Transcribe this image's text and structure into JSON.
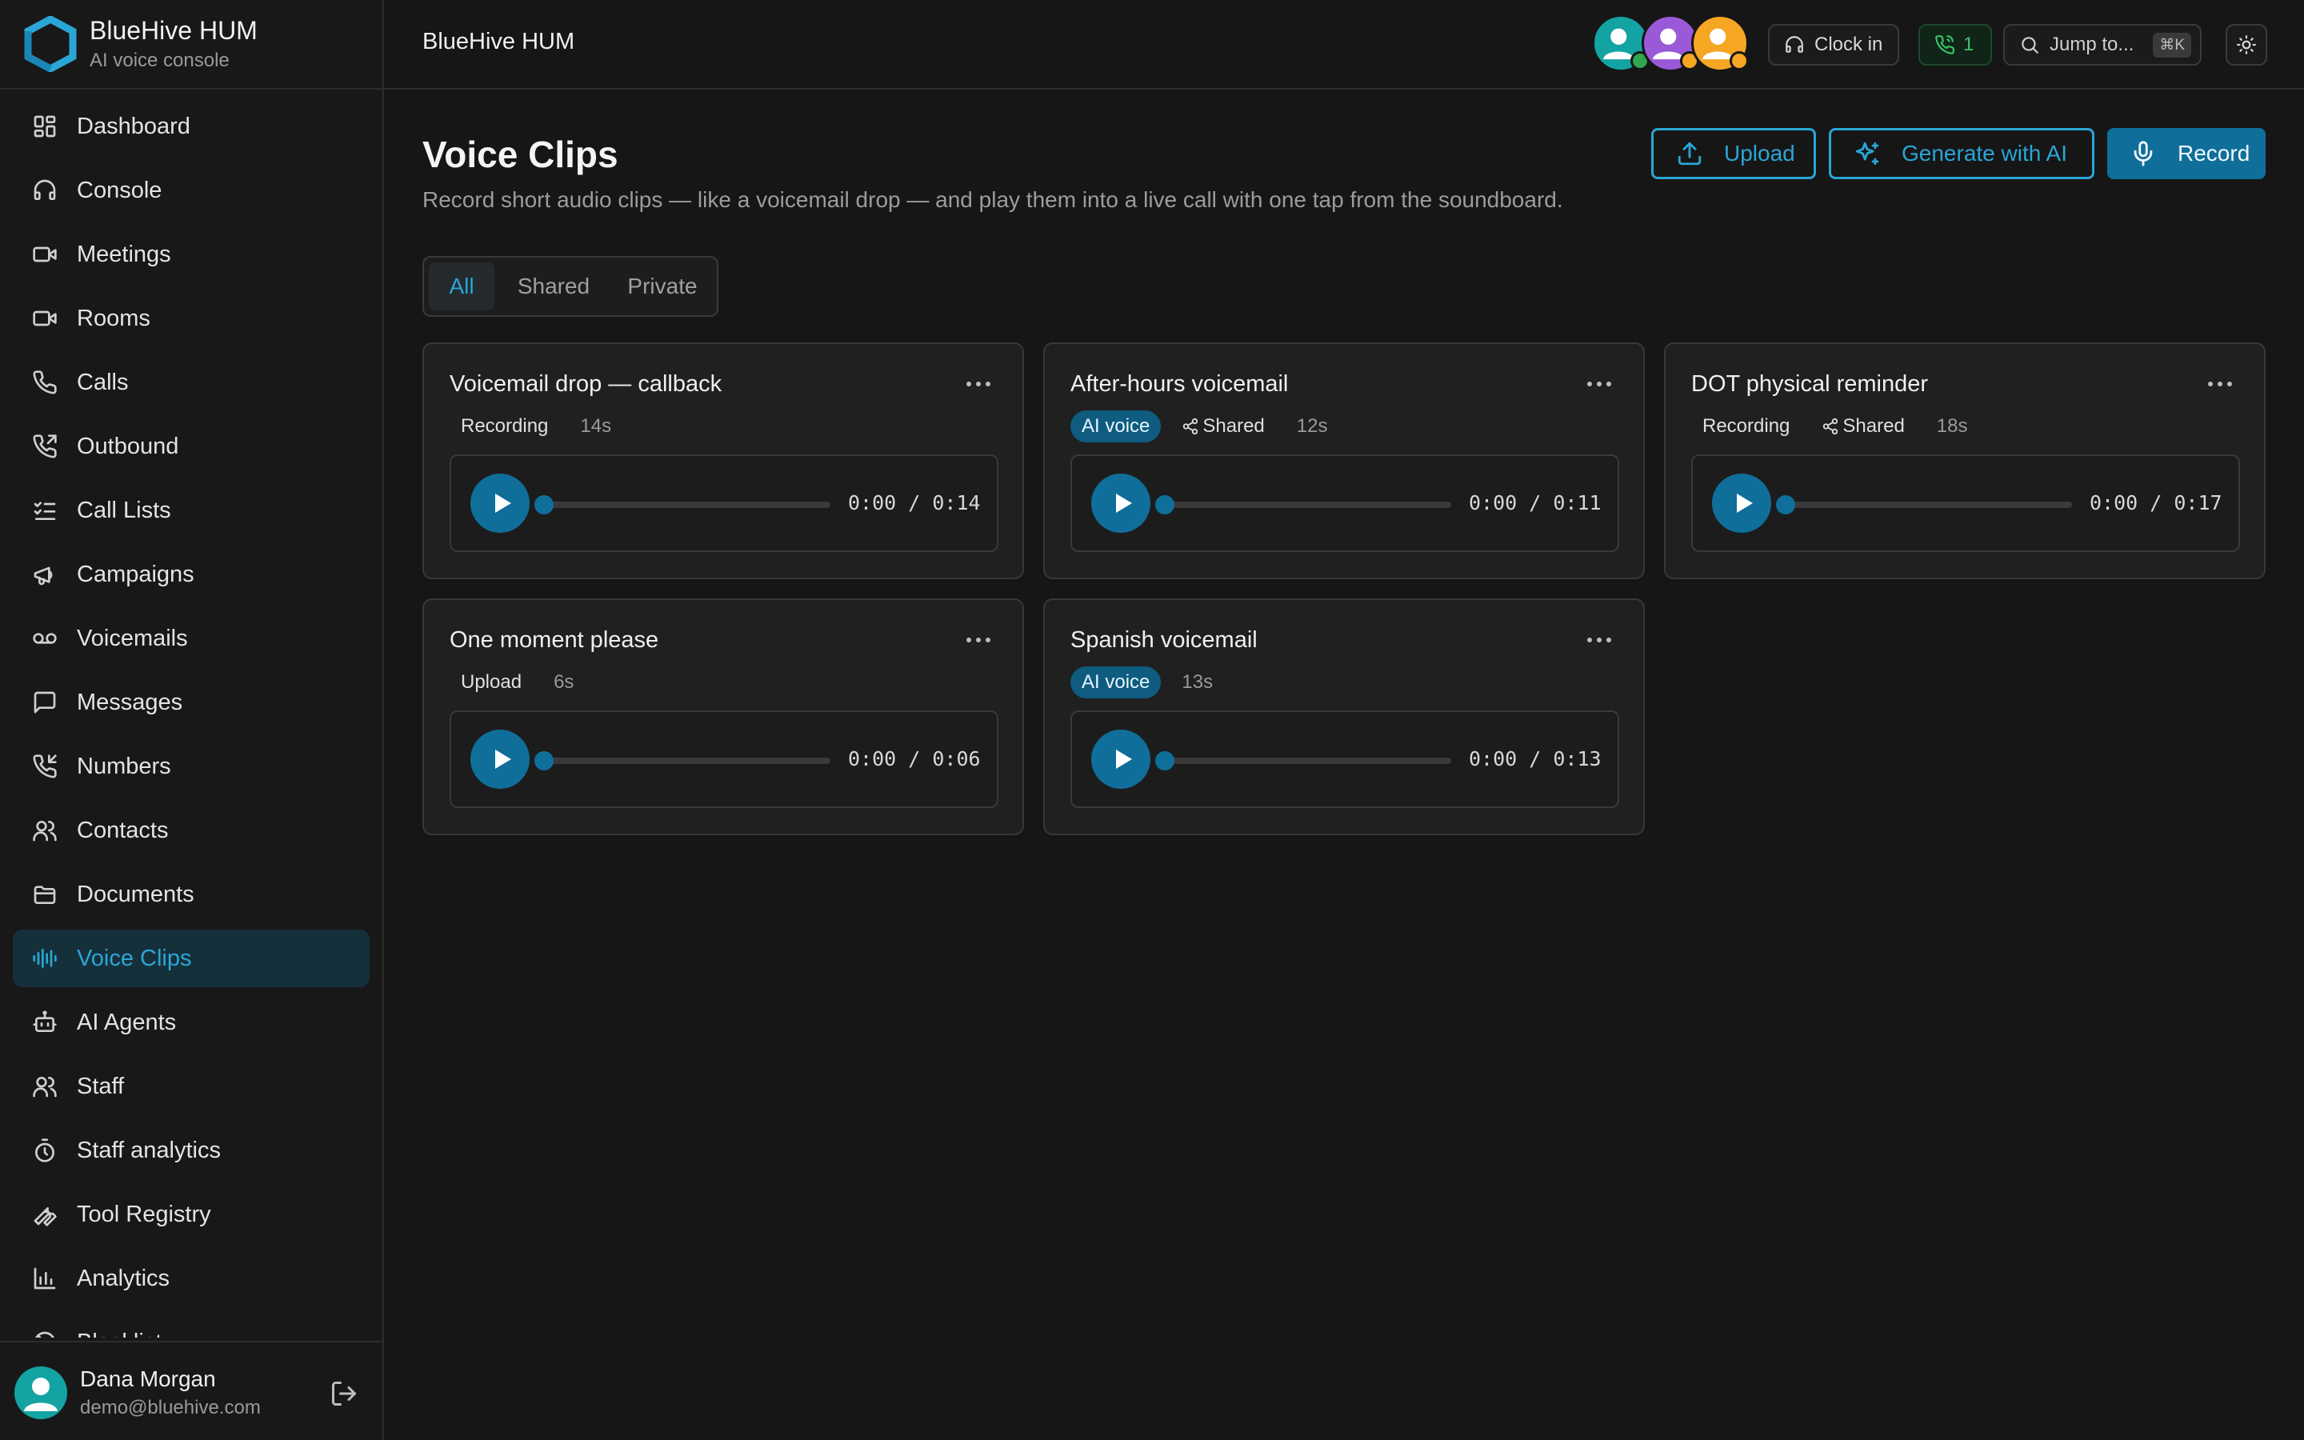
{
  "brand": {
    "title": "BlueHive HUM",
    "subtitle": "AI voice console"
  },
  "sidebar": {
    "items": [
      {
        "label": "Dashboard",
        "icon": "dashboard-icon"
      },
      {
        "label": "Console",
        "icon": "headset-icon"
      },
      {
        "label": "Meetings",
        "icon": "video-icon"
      },
      {
        "label": "Rooms",
        "icon": "video-icon"
      },
      {
        "label": "Calls",
        "icon": "phone-icon"
      },
      {
        "label": "Outbound",
        "icon": "phone-outgoing-icon"
      },
      {
        "label": "Call Lists",
        "icon": "list-checks-icon"
      },
      {
        "label": "Campaigns",
        "icon": "megaphone-icon"
      },
      {
        "label": "Voicemails",
        "icon": "voicemail-icon"
      },
      {
        "label": "Messages",
        "icon": "message-icon"
      },
      {
        "label": "Numbers",
        "icon": "phone-incoming-icon"
      },
      {
        "label": "Contacts",
        "icon": "users-icon"
      },
      {
        "label": "Documents",
        "icon": "folder-icon"
      },
      {
        "label": "Voice Clips",
        "icon": "audio-wave-icon",
        "active": true
      },
      {
        "label": "AI Agents",
        "icon": "bot-icon"
      },
      {
        "label": "Staff",
        "icon": "users-icon"
      },
      {
        "label": "Staff analytics",
        "icon": "timer-icon"
      },
      {
        "label": "Tool Registry",
        "icon": "wrench-icon"
      },
      {
        "label": "Analytics",
        "icon": "bar-chart-icon"
      },
      {
        "label": "Blacklist",
        "icon": "ban-icon"
      }
    ]
  },
  "user": {
    "name": "Dana Morgan",
    "email": "demo@bluehive.com"
  },
  "topbar": {
    "title": "BlueHive HUM",
    "clock_in": "Clock in",
    "call_count": "1",
    "jump_placeholder": "Jump to...",
    "jump_shortcut": "⌘K"
  },
  "colors": {
    "accent": "#2aa6d6",
    "primary": "#0f6f9a",
    "success": "#39c46a",
    "warning": "#f5a623"
  },
  "page": {
    "title": "Voice Clips",
    "subtitle": "Record short audio clips — like a voicemail drop — and play them into a live call with one tap from the soundboard.",
    "actions": {
      "upload": "Upload",
      "generate": "Generate with AI",
      "record": "Record"
    },
    "tabs": [
      {
        "label": "All",
        "active": true
      },
      {
        "label": "Shared"
      },
      {
        "label": "Private"
      }
    ]
  },
  "clips": [
    {
      "title": "Voicemail drop — callback",
      "source": "Recording",
      "ai": false,
      "shared": false,
      "duration": "14s",
      "time": "0:00 / 0:14"
    },
    {
      "title": "After-hours voicemail",
      "source": "AI voice",
      "ai": true,
      "shared": true,
      "duration": "12s",
      "time": "0:00 / 0:11"
    },
    {
      "title": "DOT physical reminder",
      "source": "Recording",
      "ai": false,
      "shared": true,
      "duration": "18s",
      "time": "0:00 / 0:17"
    },
    {
      "title": "One moment please",
      "source": "Upload",
      "ai": false,
      "shared": false,
      "duration": "6s",
      "time": "0:00 / 0:06"
    },
    {
      "title": "Spanish voicemail",
      "source": "AI voice",
      "ai": true,
      "shared": false,
      "duration": "13s",
      "time": "0:00 / 0:13"
    }
  ],
  "shared_label": "Shared"
}
